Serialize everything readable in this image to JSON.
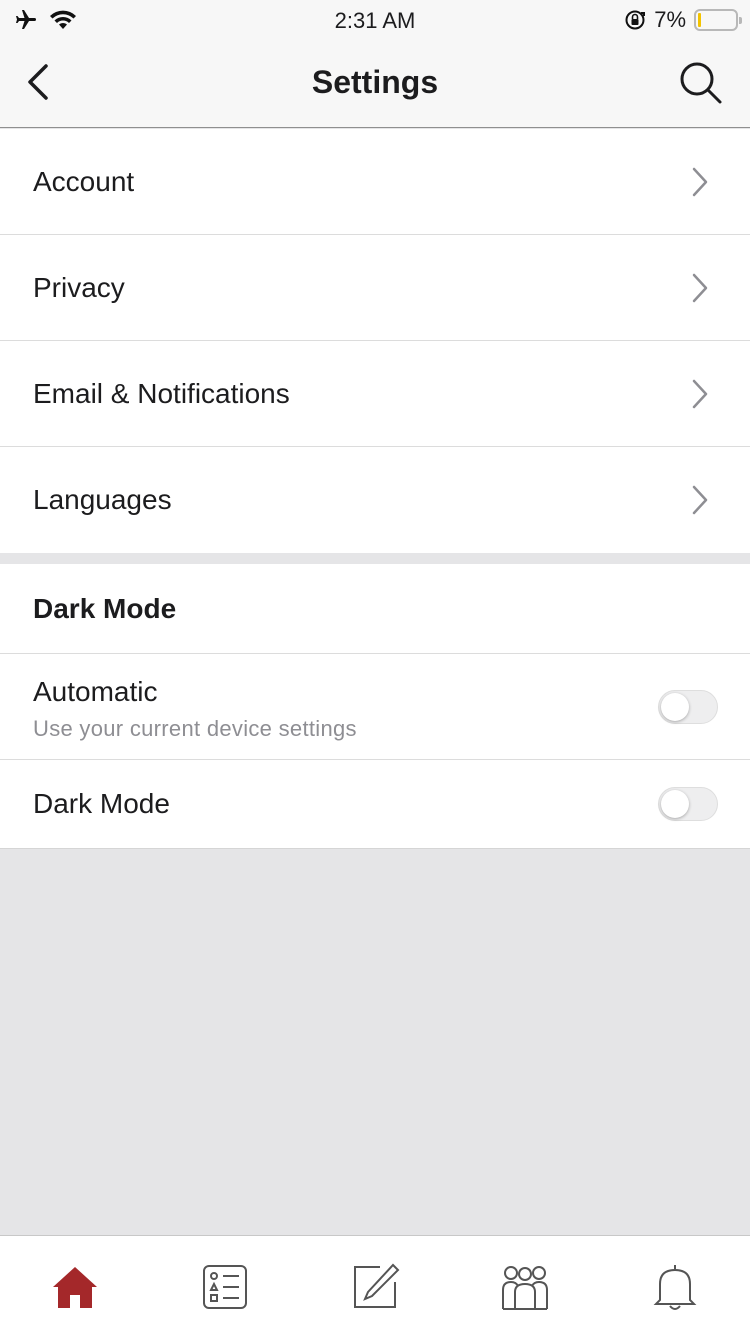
{
  "status_bar": {
    "time": "2:31 AM",
    "battery_text": "7%",
    "icons": [
      "airplane-icon",
      "wifi-icon",
      "rotation-lock-icon",
      "battery-icon"
    ]
  },
  "nav": {
    "title": "Settings",
    "back_icon": "chevron-left-icon",
    "search_icon": "search-icon"
  },
  "settings": {
    "items": [
      {
        "label": "Account"
      },
      {
        "label": "Privacy"
      },
      {
        "label": "Email & Notifications"
      },
      {
        "label": "Languages"
      }
    ]
  },
  "dark_mode": {
    "header": "Dark Mode",
    "automatic": {
      "title": "Automatic",
      "subtitle": "Use your current device settings",
      "enabled": false
    },
    "dark": {
      "title": "Dark Mode",
      "enabled": false
    }
  },
  "tab_bar": {
    "tabs": [
      {
        "icon": "home-icon",
        "active": true
      },
      {
        "icon": "list-icon",
        "active": false
      },
      {
        "icon": "compose-icon",
        "active": false
      },
      {
        "icon": "people-icon",
        "active": false
      },
      {
        "icon": "bell-icon",
        "active": false
      }
    ],
    "active_color": "#a4282a",
    "inactive_color": "#555555"
  }
}
